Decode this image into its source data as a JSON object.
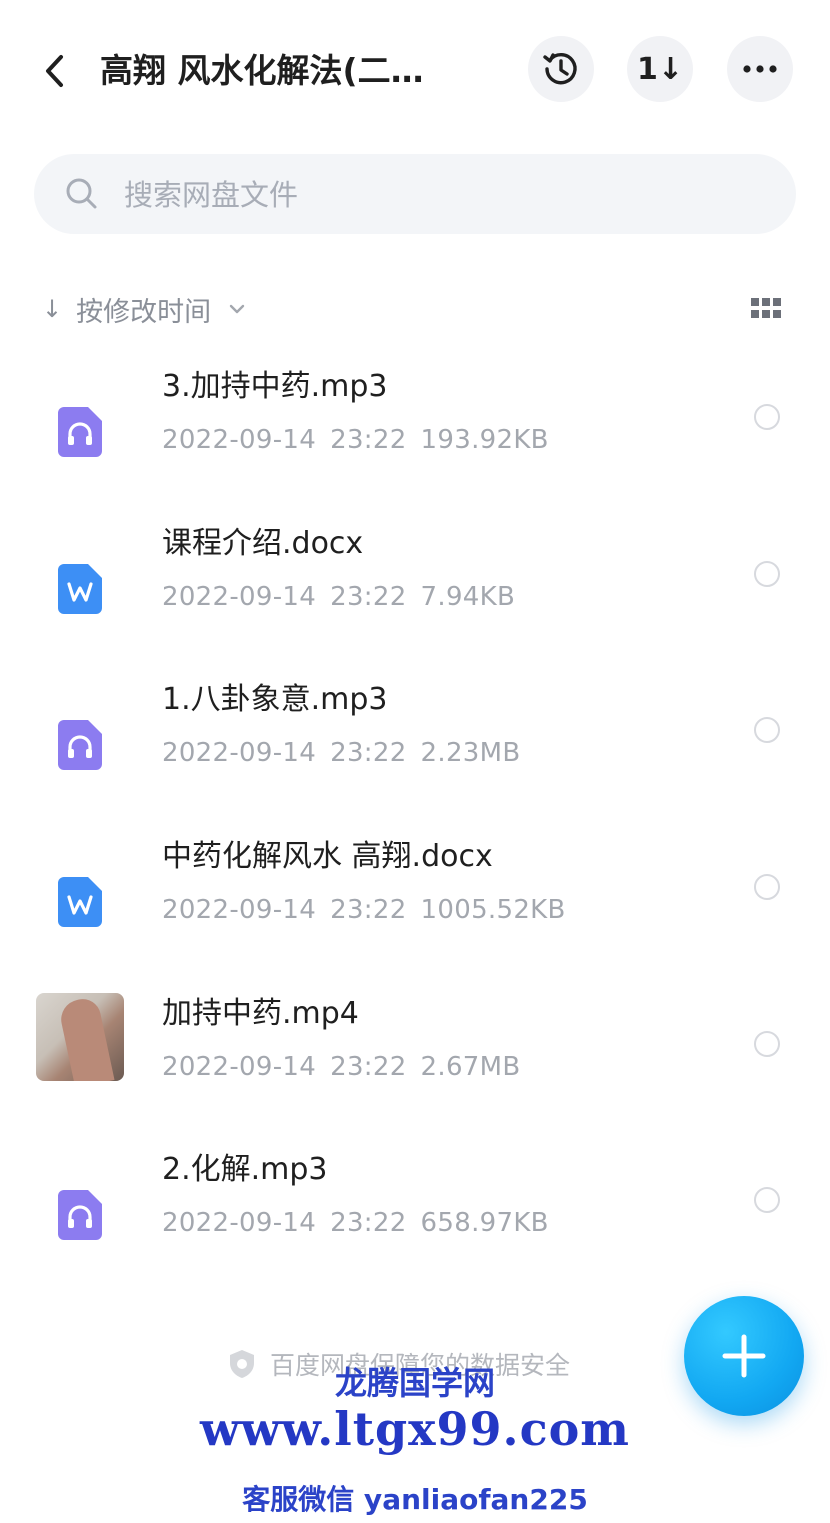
{
  "header": {
    "title": "高翔 风水化解法(二…",
    "sort_glyph": "1↓"
  },
  "search": {
    "placeholder": "搜索网盘文件"
  },
  "sort_bar": {
    "arrow": "↓",
    "label": "按修改时间"
  },
  "files": [
    {
      "name": "3.加持中药.mp3",
      "date": "2022-09-14",
      "time": "23:22",
      "size": "193.92KB",
      "type": "audio",
      "icon": "audio-file-icon"
    },
    {
      "name": "课程介绍.docx",
      "date": "2022-09-14",
      "time": "23:22",
      "size": "7.94KB",
      "type": "word",
      "icon": "word-file-icon"
    },
    {
      "name": "1.八卦象意.mp3",
      "date": "2022-09-14",
      "time": "23:22",
      "size": "2.23MB",
      "type": "audio",
      "icon": "audio-file-icon"
    },
    {
      "name": "中药化解风水 高翔.docx",
      "date": "2022-09-14",
      "time": "23:22",
      "size": "1005.52KB",
      "type": "word",
      "icon": "word-file-icon"
    },
    {
      "name": "加持中药.mp4",
      "date": "2022-09-14",
      "time": "23:22",
      "size": "2.67MB",
      "type": "video",
      "icon": "video-thumbnail"
    },
    {
      "name": "2.化解.mp3",
      "date": "2022-09-14",
      "time": "23:22",
      "size": "658.97KB",
      "type": "audio",
      "icon": "audio-file-icon"
    }
  ],
  "footer": {
    "security_text": "百度网盘保障您的数据安全"
  },
  "watermark": {
    "line1": "龙腾国学网",
    "line2": "www.ltgx99.com",
    "line3": "客服微信 yanliaofan225"
  },
  "colors": {
    "audio_icon": "#8c7cf0",
    "word_icon": "#3d8ff5",
    "fab": "#12a8f2",
    "watermark": "#2b43c8"
  }
}
